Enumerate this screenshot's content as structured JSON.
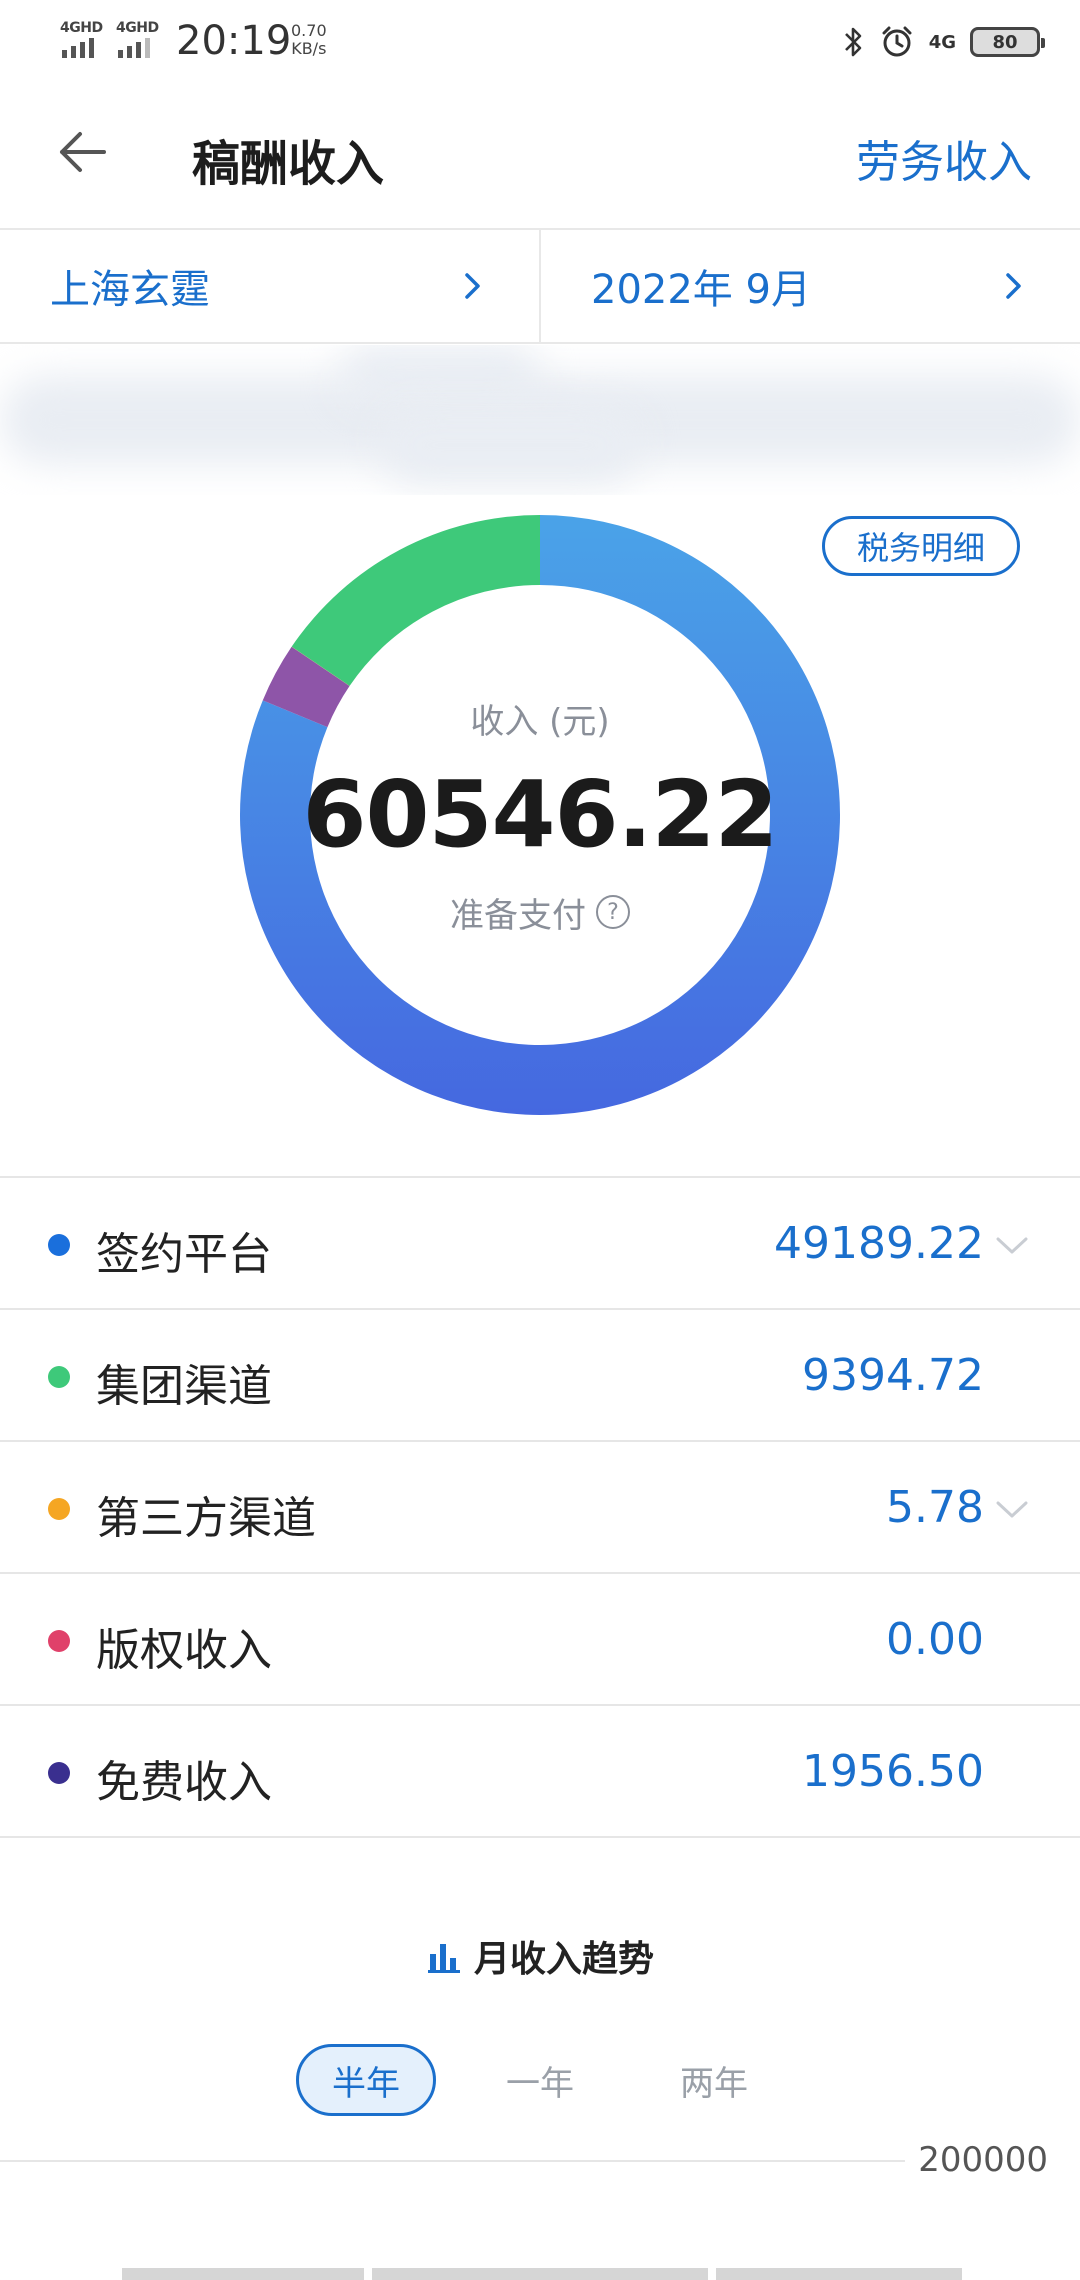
{
  "status_bar": {
    "net1": "4GHD",
    "net2": "4GHD",
    "time": "20:19",
    "speed_value": "0.70",
    "speed_unit": "KB/s",
    "net3": "4G",
    "battery": "80",
    "icons": [
      "bluetooth-icon",
      "alarm-icon"
    ]
  },
  "header": {
    "title": "稿酬收入",
    "right_link": "劳务收入",
    "back_icon": "arrow-left-icon"
  },
  "filters": {
    "company": "上海玄霆",
    "period": "2022年 9月"
  },
  "summary": {
    "tax_button": "税务明细",
    "income_label": "收入 (元)",
    "total": "60546.22",
    "status": "准备支付",
    "help_icon": "question-circle-icon"
  },
  "donut": {
    "segments": [
      {
        "name": "签约平台",
        "value": 49189.22,
        "color": "#4a7de6"
      },
      {
        "name": "集团渠道",
        "value": 9394.72,
        "color": "#3ec97a"
      },
      {
        "name": "第三方渠道",
        "value": 5.78,
        "color": "#f5a623"
      },
      {
        "name": "版权收入",
        "value": 0.0,
        "color": "#e0416a"
      },
      {
        "name": "免费收入",
        "value": 1956.5,
        "color": "#8e55a8"
      }
    ]
  },
  "breakdown": [
    {
      "name": "签约平台",
      "value": "49189.22",
      "dot_color": "#1a6fdc",
      "expandable": true
    },
    {
      "name": "集团渠道",
      "value": "9394.72",
      "dot_color": "#3ec97a",
      "expandable": false
    },
    {
      "name": "第三方渠道",
      "value": "5.78",
      "dot_color": "#f5a623",
      "expandable": true
    },
    {
      "name": "版权收入",
      "value": "0.00",
      "dot_color": "#e0416a",
      "expandable": false
    },
    {
      "name": "免费收入",
      "value": "1956.50",
      "dot_color": "#3a2f8f",
      "expandable": false
    }
  ],
  "trend": {
    "title": "月收入趋势",
    "icon": "bar-chart-icon",
    "ranges": [
      "半年",
      "一年",
      "两年"
    ],
    "active_range": "半年",
    "axis_top": "200000"
  }
}
